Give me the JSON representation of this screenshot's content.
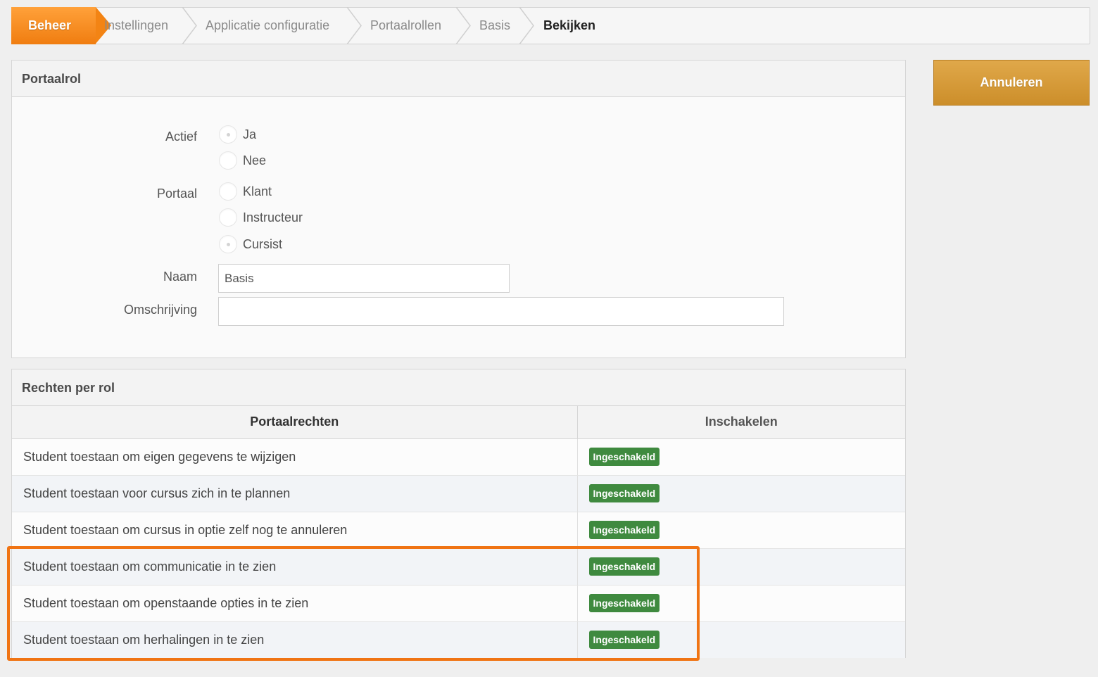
{
  "breadcrumb": {
    "items": [
      "Beheer",
      "Instellingen",
      "Applicatie configuratie",
      "Portaalrollen",
      "Basis",
      "Bekijken"
    ]
  },
  "actions": {
    "cancel_label": "Annuleren"
  },
  "portal_role_panel": {
    "title": "Portaalrol",
    "active": {
      "label": "Actief",
      "options": [
        "Ja",
        "Nee"
      ],
      "selected": "Ja"
    },
    "portal": {
      "label": "Portaal",
      "options": [
        "Klant",
        "Instructeur",
        "Cursist"
      ],
      "selected": "Cursist"
    },
    "name": {
      "label": "Naam",
      "value": "Basis"
    },
    "description": {
      "label": "Omschrijving",
      "value": ""
    }
  },
  "rights_panel": {
    "title": "Rechten per rol",
    "columns": [
      "Portaalrechten",
      "Inschakelen"
    ],
    "rows": [
      {
        "right": "Student toestaan om eigen gegevens te wijzigen",
        "status": "Ingeschakeld"
      },
      {
        "right": "Student toestaan voor cursus zich in te plannen",
        "status": "Ingeschakeld"
      },
      {
        "right": "Student toestaan om cursus in optie zelf nog te annuleren",
        "status": "Ingeschakeld"
      },
      {
        "right": "Student toestaan om communicatie in te zien",
        "status": "Ingeschakeld"
      },
      {
        "right": "Student toestaan om openstaande opties in te zien",
        "status": "Ingeschakeld"
      },
      {
        "right": "Student toestaan om herhalingen in te zien",
        "status": "Ingeschakeld"
      }
    ]
  },
  "colors": {
    "accent_orange": "#f07d10",
    "enabled_badge": "#3f8a3f",
    "cancel_button": "#d49a38",
    "highlight_border": "#f07414"
  }
}
